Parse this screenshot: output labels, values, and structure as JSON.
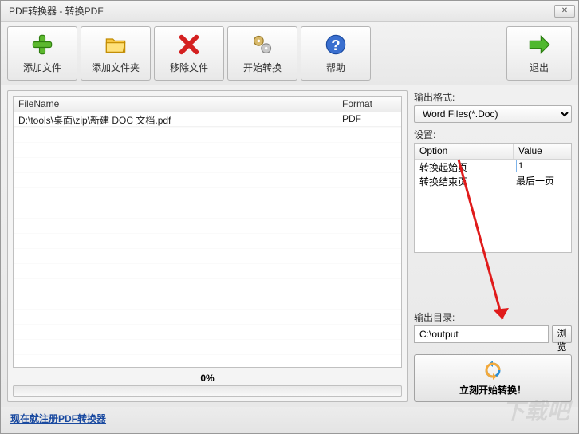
{
  "window": {
    "title": "PDF转换器 - 转换PDF"
  },
  "toolbar": {
    "add_file": "添加文件",
    "add_folder": "添加文件夹",
    "remove_file": "移除文件",
    "start_convert": "开始转换",
    "help": "帮助",
    "exit": "退出"
  },
  "file_table": {
    "headers": {
      "filename": "FileName",
      "format": "Format"
    },
    "rows": [
      {
        "filename": "D:\\tools\\桌面\\zip\\新建 DOC 文档.pdf",
        "format": "PDF"
      }
    ]
  },
  "progress": {
    "percent": "0%"
  },
  "output_format": {
    "label": "输出格式:",
    "selected": "Word Files(*.Doc)"
  },
  "settings": {
    "label": "设置:",
    "headers": {
      "option": "Option",
      "value": "Value"
    },
    "rows": [
      {
        "option": "转换起始页",
        "value": "1"
      },
      {
        "option": "转换结束页",
        "value": "最后一页"
      }
    ]
  },
  "output_dir": {
    "label": "输出目录:",
    "value": "C:\\output",
    "browse": "浏览"
  },
  "convert_now": {
    "label": "立刻开始转换！"
  },
  "footer": {
    "register_link": "现在就注册PDF转换器"
  },
  "watermark": "下载吧"
}
